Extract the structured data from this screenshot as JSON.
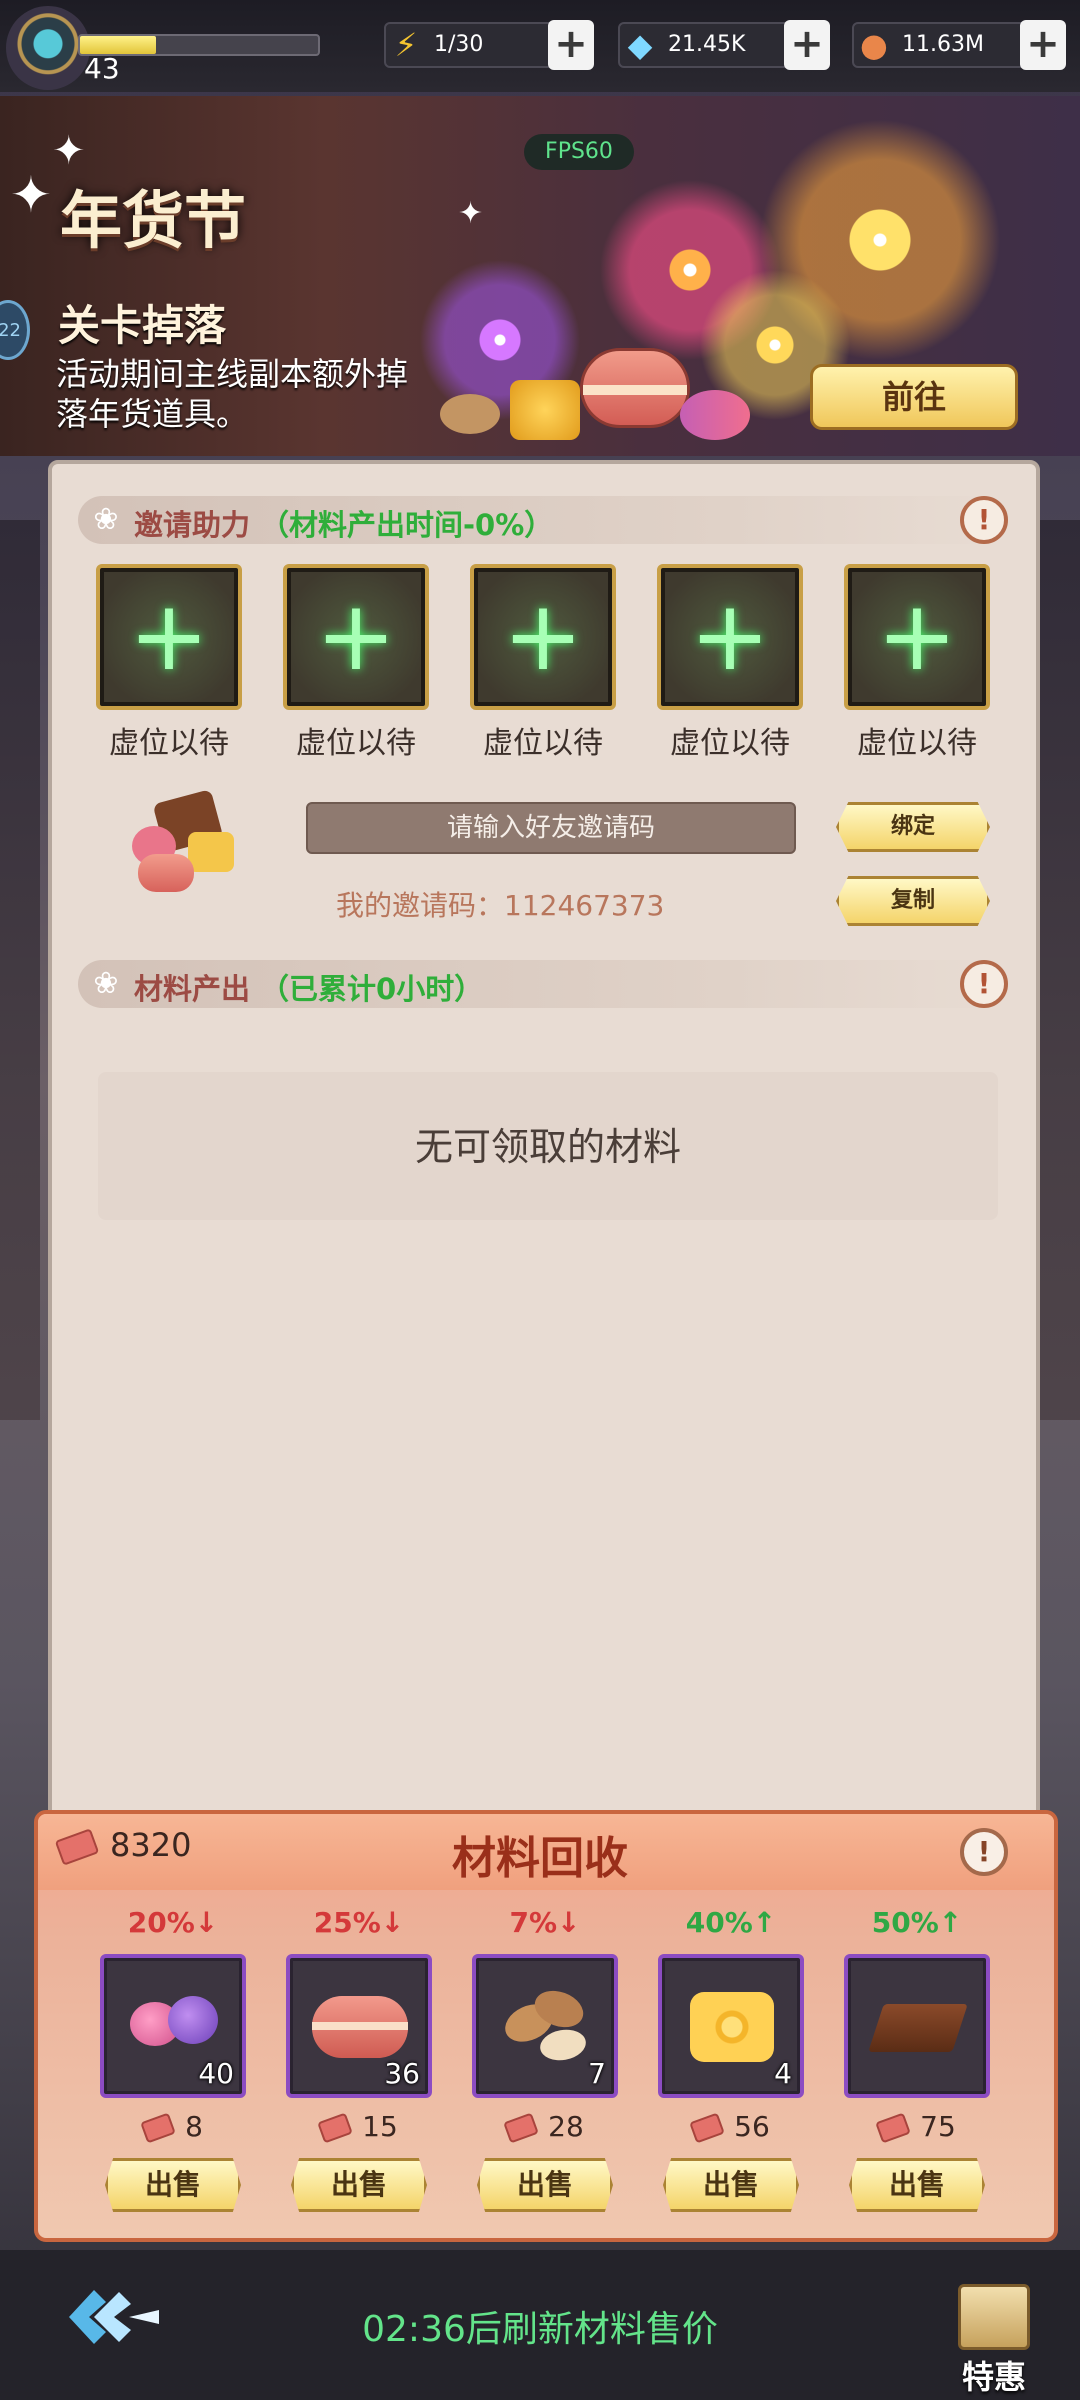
{
  "topbar": {
    "level": "43",
    "xp_progress": 0.32,
    "energy": "1/30",
    "diamonds": "21.45K",
    "coins": "11.63M",
    "plus_label": "+"
  },
  "banner": {
    "fps": "FPS60",
    "title": "年货节",
    "subtitle": "关卡掉落",
    "description": "活动期间主线副本额外掉落年货道具。",
    "go_button": "前往",
    "side_badge": "22"
  },
  "invite": {
    "header": "邀请助力",
    "header_note": "（材料产出时间-0%）",
    "slots": [
      {
        "label": "虚位以待"
      },
      {
        "label": "虚位以待"
      },
      {
        "label": "虚位以待"
      },
      {
        "label": "虚位以待"
      },
      {
        "label": "虚位以待"
      }
    ],
    "input_placeholder": "请输入好友邀请码",
    "bind_button": "绑定",
    "copy_button": "复制",
    "my_code": "我的邀请码：112467373"
  },
  "output": {
    "header": "材料产出",
    "header_note": "（已累计0小时）",
    "empty_text": "无可领取的材料"
  },
  "recycle": {
    "title": "材料回收",
    "balance": "8320",
    "items": [
      {
        "name": "candy",
        "change": "20%↓",
        "trend": "down",
        "count": "40",
        "price": "8",
        "sell": "出售"
      },
      {
        "name": "macaron",
        "change": "25%↓",
        "trend": "down",
        "count": "36",
        "price": "15",
        "sell": "出售"
      },
      {
        "name": "almonds",
        "change": "7%↓",
        "trend": "down",
        "count": "7",
        "price": "28",
        "sell": "出售"
      },
      {
        "name": "honeycomb",
        "change": "40%↑",
        "trend": "up",
        "count": "4",
        "price": "56",
        "sell": "出售"
      },
      {
        "name": "chocolate",
        "change": "50%↑",
        "trend": "up",
        "count": "",
        "price": "75",
        "sell": "出售"
      }
    ]
  },
  "bottom": {
    "refresh_text": "02:36后刷新材料售价",
    "gift_label": "特惠"
  },
  "colors": {
    "accent_green": "#63e48a",
    "header_red": "#9c4b44",
    "note_green": "#2fae3a",
    "down_red": "#d4393a",
    "up_green": "#2fa844",
    "item_border": "#8c4cc2"
  }
}
